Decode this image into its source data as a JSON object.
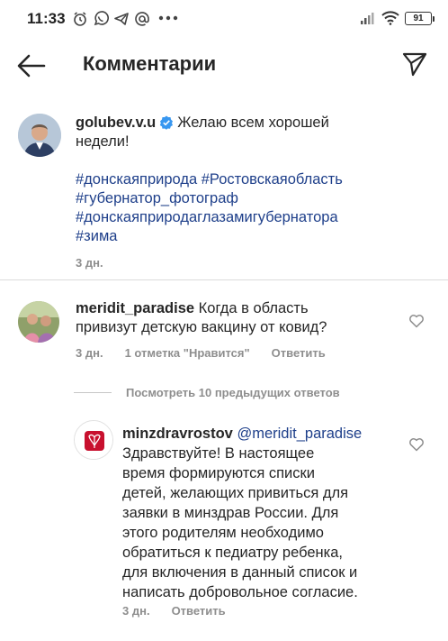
{
  "status_bar": {
    "time": "11:33",
    "battery": "91"
  },
  "header": {
    "title": "Комментарии"
  },
  "post": {
    "username": "golubev.v.u",
    "text_line1": "Желаю всем хорошей",
    "text_line2": "недели!",
    "hashtags": [
      "#донскаяприрода #Ростовскаяобласть",
      "#губернатор_фотограф",
      "#донскаяприродаглазамигубернатора",
      "#зима"
    ],
    "time": "3 дн."
  },
  "comment": {
    "username": "meridit_paradise",
    "text_line1": "Когда в область",
    "text_line2": "привизут детскую вакцину от ковид?",
    "time": "3 дн.",
    "likes": "1 отметка \"Нравится\"",
    "reply": "Ответить"
  },
  "view_previous": "Посмотреть 10 предыдущих ответов",
  "reply": {
    "username": "minzdravrostov",
    "mention": "@meridit_paradise",
    "lines": [
      "Здравствуйте! В настоящее",
      "время формируются списки",
      "детей, желающих привиться для",
      "заявки в минздрав России. Для",
      "этого родителям необходимо",
      "обратиться к педиатру ребенка,",
      "для включения в данный список и",
      "написать добровольное согласие."
    ],
    "time": "3 дн.",
    "reply": "Ответить"
  },
  "colors": {
    "hashtag": "#1e3f8a",
    "verified": "#3897f0",
    "meta": "#8e8e8e"
  }
}
